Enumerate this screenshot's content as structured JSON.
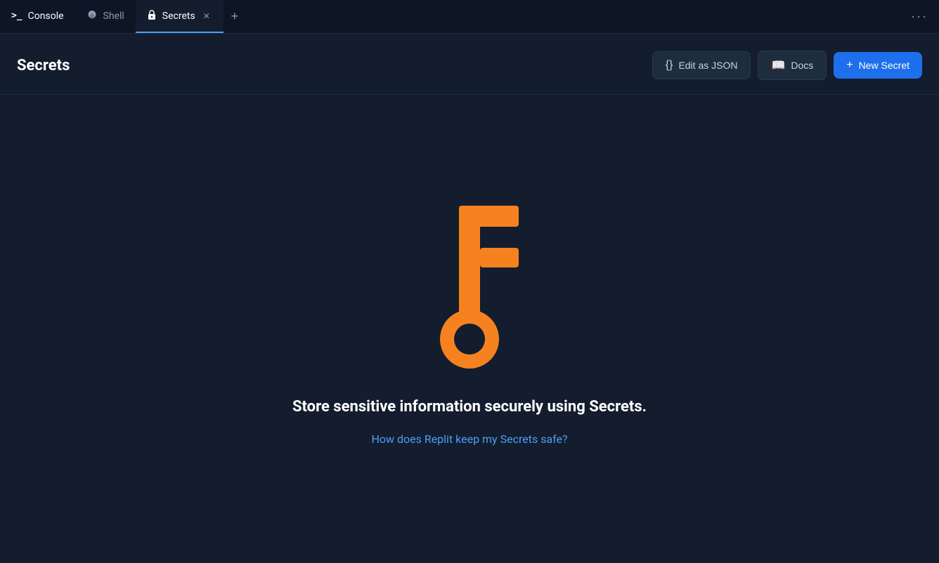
{
  "tabs": [
    {
      "id": "console",
      "label": "Console",
      "icon": ">_",
      "active": false,
      "closeable": false
    },
    {
      "id": "shell",
      "label": "Shell",
      "icon": "shell",
      "active": false,
      "closeable": false
    },
    {
      "id": "secrets",
      "label": "Secrets",
      "icon": "lock",
      "active": true,
      "closeable": true
    }
  ],
  "tab_more_label": "···",
  "tab_add_label": "+",
  "page": {
    "title": "Secrets",
    "header_actions": {
      "edit_json_label": "Edit as JSON",
      "docs_label": "Docs",
      "new_secret_label": "New Secret"
    },
    "empty_state": {
      "title": "Store sensitive information securely using Secrets.",
      "link_text": "How does Replit keep my Secrets safe?"
    }
  },
  "colors": {
    "accent_blue": "#1e6fec",
    "accent_orange": "#f5821f",
    "bg_dark": "#0e1525",
    "bg_panel": "#131d2e",
    "border": "#1e2d3d",
    "text_muted": "#8b9ab1",
    "text_primary": "#ffffff"
  }
}
